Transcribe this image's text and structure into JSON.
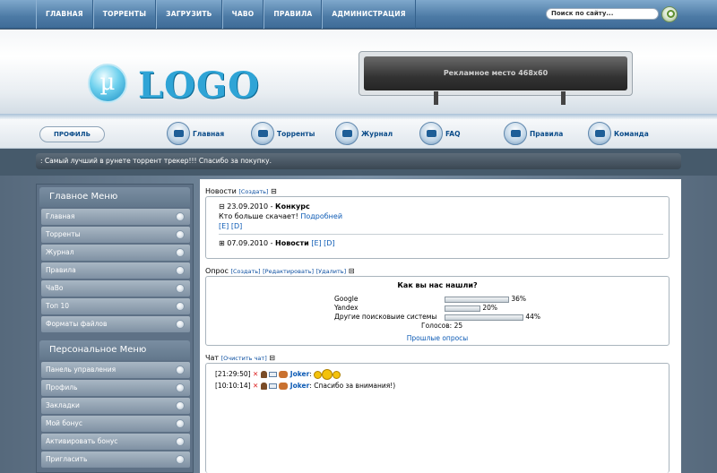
{
  "topnav": {
    "items": [
      "ГЛАВНАЯ",
      "ТОРРЕНТЫ",
      "ЗАГРУЗИТЬ",
      "ЧАВО",
      "ПРАВИЛА",
      "АДМИНИСТРАЦИЯ"
    ],
    "search_text": "Поиск по сайту..."
  },
  "header": {
    "logo_letter": "µ",
    "logo_text": "LOGO",
    "ad_text": "Рекламное место 468x60"
  },
  "iconnav": {
    "profile": "ПРОФИЛЬ",
    "items": [
      "Главная",
      "Торренты",
      "Журнал",
      "FAQ",
      "Правила",
      "Команда"
    ]
  },
  "marquee": ": Самый лучший в рунете торрент трекер!!! Спасибо за покупку.",
  "sidebar": {
    "main_title": "Главное Меню",
    "main_items": [
      "Главная",
      "Торренты",
      "Журнал",
      "Правила",
      "ЧаВо",
      "Топ 10",
      "Форматы файлов"
    ],
    "personal_title": "Персональное Меню",
    "personal_items": [
      "Панель управления",
      "Профиль",
      "Закладки",
      "Мой бонус",
      "Активировать бонус",
      "Пригласить"
    ]
  },
  "news": {
    "title": "Новости",
    "create": "[Создать]",
    "items": [
      {
        "date": "23.09.2010",
        "sep": " - ",
        "title": "Конкурс",
        "body": "Кто больше скачает! ",
        "link": "Подробней",
        "actions": "[E] [D]"
      },
      {
        "date": "07.09.2010",
        "sep": " - ",
        "title": "Новости",
        "actions": "[E] [D]"
      }
    ]
  },
  "poll": {
    "title": "Опрос",
    "actions": [
      "[Создать]",
      "[Редактировать]",
      "[Удалить]"
    ],
    "question": "Как вы нас нашли?",
    "options": [
      {
        "label": "Google",
        "percent": "36%",
        "value": 36
      },
      {
        "label": "Yandex",
        "percent": "20%",
        "value": 20
      },
      {
        "label": "Другие поисковыие системы",
        "percent": "44%",
        "value": 44
      }
    ],
    "votes": "Голосов: 25",
    "past": "Прошлые опросы"
  },
  "chat": {
    "title": "Чат",
    "clear": "[Очистить чат]",
    "messages": [
      {
        "time": "[21:29:50]",
        "user": "Joker",
        "text": ""
      },
      {
        "time": "[10:10:14]",
        "user": "Joker",
        "text": " Спасибо за внимания!)"
      }
    ]
  }
}
